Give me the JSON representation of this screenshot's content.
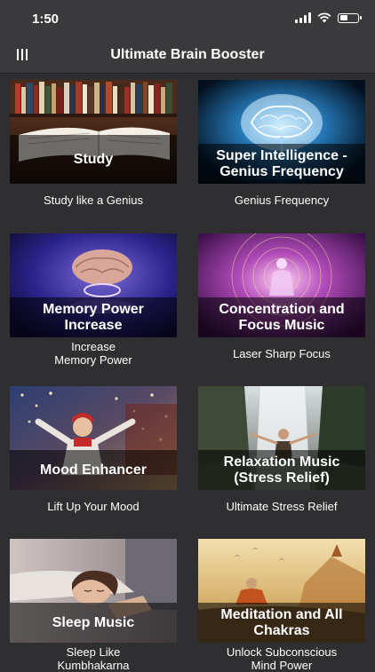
{
  "status_bar": {
    "time": "1:50"
  },
  "header": {
    "title": "Ultimate Brain Booster",
    "menu_icon": "menu-icon"
  },
  "tiles": [
    {
      "title": "Study",
      "subtitle": "Study like a Genius"
    },
    {
      "title": "Super Intelligence - Genius Frequency",
      "subtitle": "Genius Frequency"
    },
    {
      "title": "Memory Power Increase",
      "subtitle": "Increase\nMemory Power"
    },
    {
      "title": "Concentration and Focus Music",
      "subtitle": "Laser Sharp Focus"
    },
    {
      "title": "Mood Enhancer",
      "subtitle": "Lift Up Your Mood"
    },
    {
      "title": "Relaxation Music (Stress Relief)",
      "subtitle": "Ultimate Stress Relief"
    },
    {
      "title": "Sleep Music",
      "subtitle": "Sleep Like\nKumbhakarna"
    },
    {
      "title": "Meditation and All Chakras",
      "subtitle": "Unlock Subconscious\nMind Power"
    }
  ]
}
